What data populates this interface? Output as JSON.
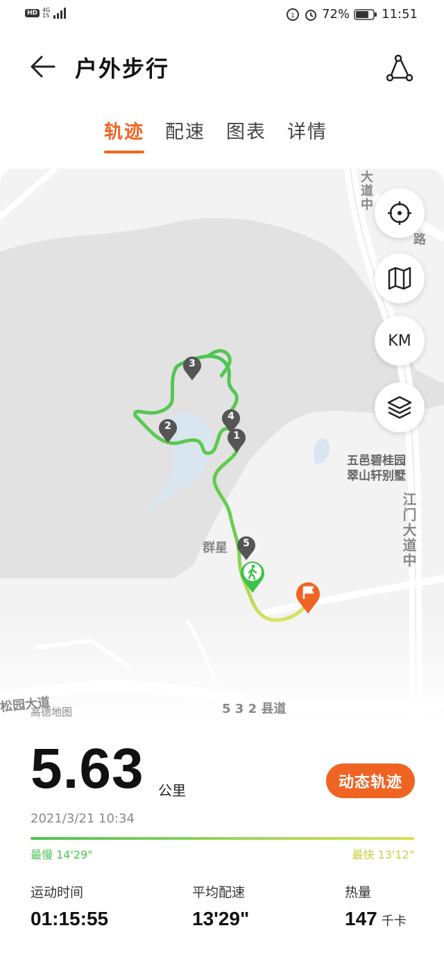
{
  "status_bar": {
    "network_badge": "HD",
    "network_type": "4G",
    "network_sub": "1S",
    "battery": "72%",
    "time": "11:51"
  },
  "header": {
    "title": "户外步行",
    "back_icon": "arrow-left-icon",
    "share_icon": "share-icon"
  },
  "tabs": [
    {
      "label": "轨迹",
      "active": true
    },
    {
      "label": "配速",
      "active": false
    },
    {
      "label": "图表",
      "active": false
    },
    {
      "label": "详情",
      "active": false
    }
  ],
  "map": {
    "labels": {
      "road_avenue_top": "大道中",
      "road_top_right": "路",
      "estate": "五邑碧桂园\n翠山轩别墅",
      "jiangmen_avenue": "江门大道中",
      "park": "群星",
      "songyuan_avenue": "松园大道",
      "county_road": "5 3 2 县道"
    },
    "provider": "高德地图",
    "controls": {
      "locate_icon": "crosshair-icon",
      "map_type_icon": "map-icon",
      "km_label": "KM",
      "layers_icon": "layers-icon"
    },
    "km_markers": [
      "1",
      "2",
      "3",
      "4",
      "5"
    ],
    "colors": {
      "route_start": "#4cc452",
      "route_end": "#d6e05a",
      "finish": "#f06423"
    }
  },
  "summary": {
    "distance": "5.63",
    "distance_unit": "公里",
    "replay_button": "动态轨迹",
    "datetime": "2021/3/21 10:34",
    "pace_slowest": "最慢 14'29\"",
    "pace_fastest": "最快 13'12\""
  },
  "metrics": {
    "duration_label": "运动时间",
    "duration_value": "01:15:55",
    "avg_pace_label": "平均配速",
    "avg_pace_value": "13'29\"",
    "calories_label": "热量",
    "calories_value": "147",
    "calories_unit": "千卡"
  },
  "colors": {
    "accent": "#f06423"
  }
}
